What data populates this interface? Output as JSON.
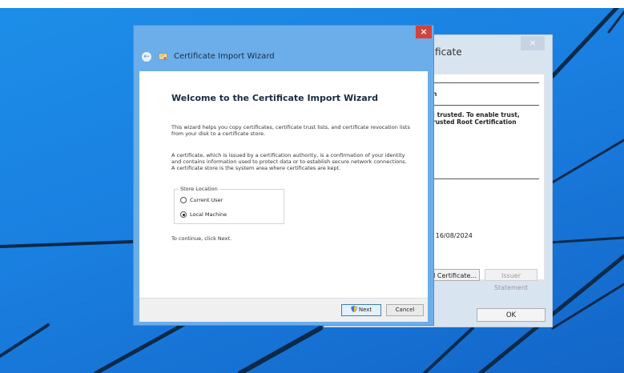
{
  "background_dialog": {
    "title_fragment": "ficate",
    "close_label": "×",
    "heading_fragment": "n",
    "warning_line1": ": trusted. To enable trust,",
    "warning_line2": "rusted Root Certification",
    "valid_date": "› 16/08/2024",
    "install_button": "ll Certificate...",
    "issuer_button": "Issuer Statement",
    "ok_button": "OK"
  },
  "wizard": {
    "title": "Certificate Import Wizard",
    "close_label": "×",
    "back_icon": "back-arrow-icon",
    "heading": "Welcome to the Certificate Import Wizard",
    "intro": "This wizard helps you copy certificates, certificate trust lists, and certificate revocation lists from your disk to a certificate store.",
    "description": "A certificate, which is issued by a certification authority, is a confirmation of your identity and contains information used to protect data or to establish secure network connections. A certificate store is the system area where certificates are kept.",
    "store_location": {
      "legend": "Store Location",
      "options": [
        {
          "label": "Current User",
          "selected": false
        },
        {
          "label": "Local Machine",
          "selected": true
        }
      ]
    },
    "continue_text": "To continue, click Next.",
    "next_button": "Next",
    "cancel_button": "Cancel"
  },
  "colors": {
    "desktop": "#1a7fe0",
    "wizard_frame": "#6caeea",
    "close_button": "#d3433b"
  }
}
